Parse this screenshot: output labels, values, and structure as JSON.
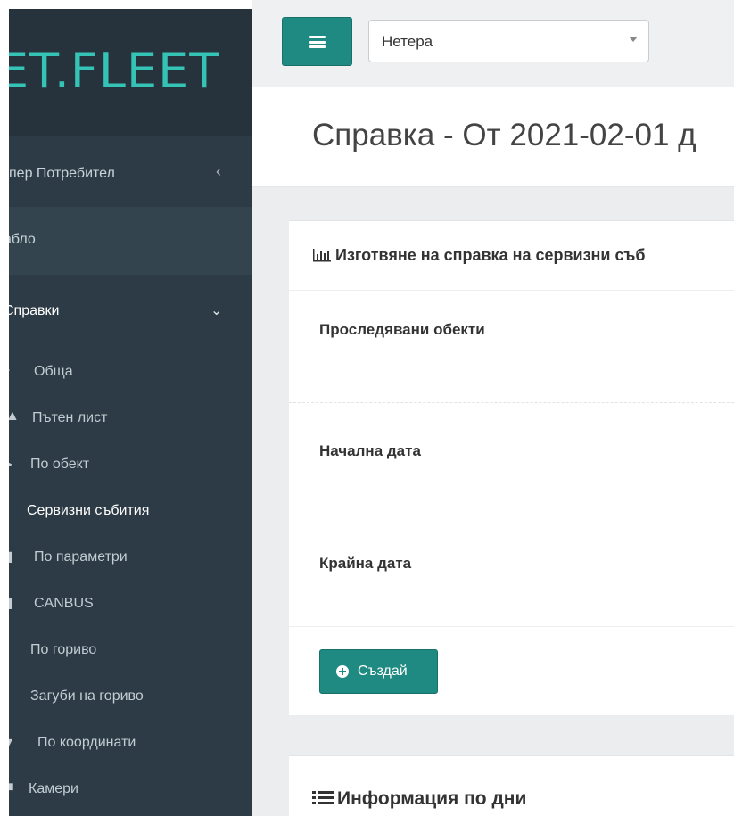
{
  "sidebar": {
    "logo": "ET.FLEET",
    "user": "упер Потребител",
    "dashboard": "абло",
    "reports": "Справки",
    "items": [
      {
        "label": "Обща",
        "icon": "chevron-icon"
      },
      {
        "label": "Пътен лист",
        "icon": "road-icon"
      },
      {
        "label": "По обект",
        "icon": "caret-right-icon"
      },
      {
        "label": "Сервизни събития",
        "icon": ""
      },
      {
        "label": "По параметри",
        "icon": "list-icon"
      },
      {
        "label": "CANBUS",
        "icon": "list-icon"
      },
      {
        "label": "По гориво",
        "icon": ""
      },
      {
        "label": "Загуби на гориво",
        "icon": ""
      },
      {
        "label": "По координати",
        "icon": "pin-icon"
      },
      {
        "label": "Камери",
        "icon": "camera-icon"
      }
    ]
  },
  "topbar": {
    "object_select": "Нетера"
  },
  "page": {
    "title": "Справка - От 2021-02-01 д"
  },
  "panel": {
    "title": "Изготвяне на справка на сервизни съб",
    "fields": {
      "objects": "Проследявани обекти",
      "start_date": "Начална дата",
      "end_date": "Крайна дата"
    },
    "create_label": "Създай"
  },
  "panel2": {
    "title": "Информация по дни"
  }
}
